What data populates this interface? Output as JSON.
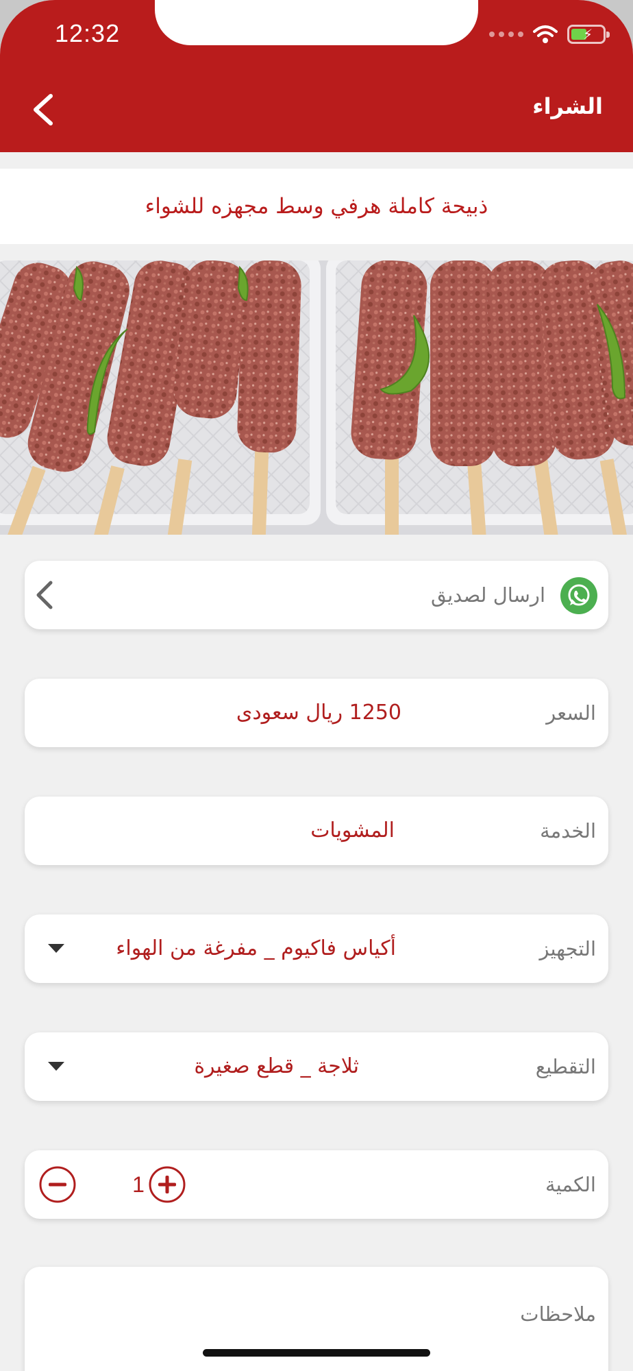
{
  "status_bar": {
    "time": "12:32"
  },
  "nav": {
    "title": "الشراء"
  },
  "product": {
    "title": "ذبيحة كاملة هرفي وسط مجهزه للشواء"
  },
  "share": {
    "label": "ارسال لصديق"
  },
  "price": {
    "label": "السعر",
    "value": "1250 ريال سعودى"
  },
  "service": {
    "label": "الخدمة",
    "value": "المشويات"
  },
  "preparation": {
    "label": "التجهيز",
    "value": "أكياس فاكيوم _ مفرغة من الهواء"
  },
  "cutting": {
    "label": "التقطيع",
    "value": "ثلاجة _ قطع صغيرة"
  },
  "quantity": {
    "label": "الكمية",
    "value": "1"
  },
  "notes": {
    "label": "ملاحظات"
  },
  "colors": {
    "header": "#b91c1c",
    "accent": "#b01e1e",
    "whatsapp": "#4caf50",
    "background": "#f0f0f0"
  },
  "icons": {
    "back": "chevron-left-icon",
    "share": "whatsapp-icon",
    "share_arrow": "chevron-left-icon",
    "dropdown": "caret-down-icon",
    "increment": "plus-circle-icon",
    "decrement": "minus-circle-icon"
  }
}
